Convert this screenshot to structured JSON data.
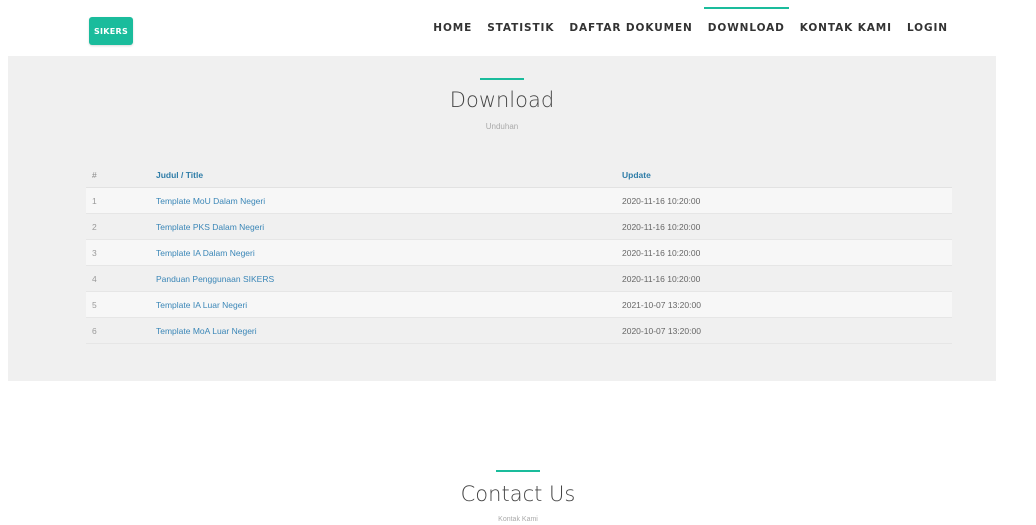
{
  "brand": {
    "logo_text": "SIKERS",
    "accent_color": "#1abc9c"
  },
  "nav": {
    "items": [
      {
        "label": "HOME",
        "active": false
      },
      {
        "label": "STATISTIK",
        "active": false
      },
      {
        "label": "DAFTAR DOKUMEN",
        "active": false
      },
      {
        "label": "DOWNLOAD",
        "active": true
      },
      {
        "label": "KONTAK KAMI",
        "active": false
      },
      {
        "label": "LOGIN",
        "active": false
      }
    ]
  },
  "download": {
    "title": "Download",
    "subtitle": "Unduhan",
    "table": {
      "headers": {
        "num": "#",
        "title": "Judul / Title",
        "update": "Update"
      },
      "rows": [
        {
          "num": "1",
          "title": "Template MoU Dalam Negeri",
          "update": "2020-11-16 10:20:00"
        },
        {
          "num": "2",
          "title": "Template PKS Dalam Negeri",
          "update": "2020-11-16 10:20:00"
        },
        {
          "num": "3",
          "title": "Template IA Dalam Negeri",
          "update": "2020-11-16 10:20:00"
        },
        {
          "num": "4",
          "title": "Panduan Penggunaan SIKERS",
          "update": "2020-11-16 10:20:00"
        },
        {
          "num": "5",
          "title": "Template IA Luar Negeri",
          "update": "2021-10-07 13:20:00"
        },
        {
          "num": "6",
          "title": "Template MoA Luar Negeri",
          "update": "2020-10-07 13:20:00"
        }
      ]
    }
  },
  "contact": {
    "title": "Contact Us",
    "subtitle": "Kontak Kami"
  }
}
